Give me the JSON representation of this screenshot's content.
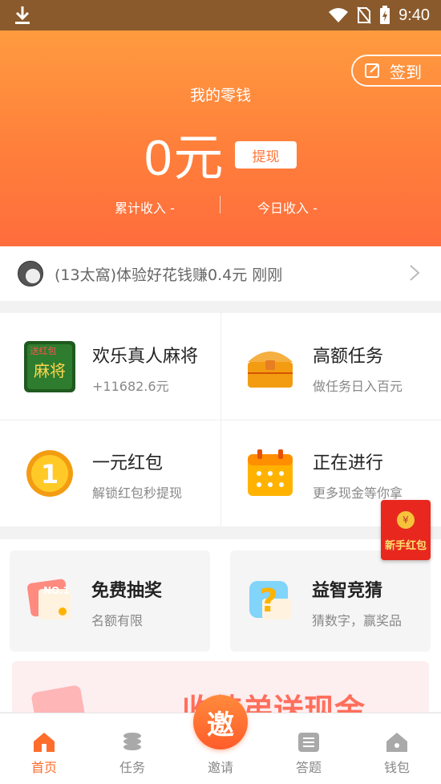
{
  "status_bar": {
    "time": "9:40"
  },
  "header": {
    "checkin_label": "签到",
    "title": "我的零钱",
    "amount": "0元",
    "withdraw_label": "提现",
    "total_income": "累计收入 -",
    "today_income": "今日收入 -"
  },
  "ticker": {
    "message": "(13太窩)体验好花钱赚0.4元 刚刚"
  },
  "grid": [
    {
      "title": "欢乐真人麻将",
      "subtitle": "+11682.6元",
      "icon": "mahjong-icon"
    },
    {
      "title": "高额任务",
      "subtitle": "做任务日入百元",
      "icon": "treasure-chest-icon"
    },
    {
      "title": "一元红包",
      "subtitle": "解锁红包秒提现",
      "icon": "one-coin-icon"
    },
    {
      "title": "正在进行",
      "subtitle": "更多现金等你拿",
      "icon": "calendar-icon"
    }
  ],
  "cards": [
    {
      "title": "免费抽奖",
      "subtitle": "名额有限",
      "icon": "lottery-ticket-icon"
    },
    {
      "title": "益智竞猜",
      "subtitle": "猜数字，赢奖品",
      "icon": "question-mark-icon"
    }
  ],
  "banner": {
    "text": "收徒弟送现金"
  },
  "floating": {
    "newbie_label": "新手红包",
    "coin_symbol": "¥"
  },
  "tabs": [
    {
      "label": "首页",
      "icon": "home-icon",
      "active": true
    },
    {
      "label": "任务",
      "icon": "coins-stack-icon",
      "active": false
    },
    {
      "label": "邀请",
      "icon": "invite-icon",
      "active": false
    },
    {
      "label": "答题",
      "icon": "quiz-icon",
      "active": false
    },
    {
      "label": "钱包",
      "icon": "wallet-icon",
      "active": false
    }
  ],
  "invite_glyph": "邀",
  "colors": {
    "accent": "#ff6d2c",
    "status_bar": "#8a5a2c",
    "hero_top": "#ff9b3f",
    "hero_bottom": "#ff6d3c"
  }
}
